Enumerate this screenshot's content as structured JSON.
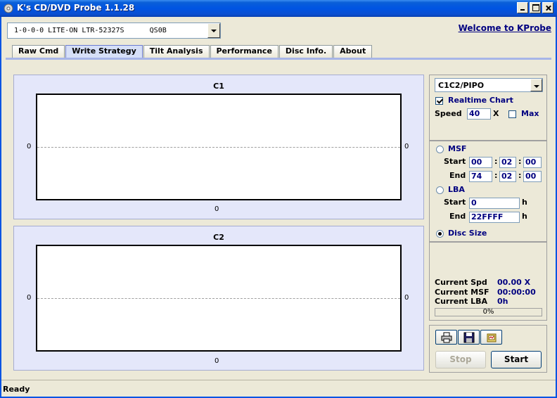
{
  "window": {
    "title": "K's CD/DVD Probe 1.1.28",
    "accent": "#0054e3"
  },
  "drive": {
    "selected": "1-0-0-0 LITE-ON LTR-52327S      QS0B"
  },
  "welcome_link": "Welcome to KProbe",
  "tabs": [
    {
      "label": "Raw Cmd"
    },
    {
      "label": "Write Strategy",
      "active": true
    },
    {
      "label": "Tilt Analysis"
    },
    {
      "label": "Performance"
    },
    {
      "label": "Disc Info."
    },
    {
      "label": "About"
    }
  ],
  "charts": {
    "c1": {
      "title": "C1",
      "y_left": "0",
      "y_right": "0",
      "x_tick": "0"
    },
    "c2": {
      "title": "C2",
      "y_left": "0",
      "y_right": "0",
      "x_tick": "0"
    }
  },
  "chart_data": [
    {
      "type": "line",
      "title": "C1",
      "series": [],
      "yticks": [
        "0"
      ],
      "xticks": [
        "0"
      ],
      "grid": "zero line dashed"
    },
    {
      "type": "line",
      "title": "C2",
      "series": [],
      "yticks": [
        "0"
      ],
      "xticks": [
        "0"
      ],
      "grid": "zero line dashed"
    }
  ],
  "settings": {
    "mode": "C1C2/PIPO",
    "realtime_chart_label": "Realtime Chart",
    "realtime_chart_checked": true,
    "speed_label": "Speed",
    "speed_value": "40",
    "speed_unit": "X",
    "max_label": "Max",
    "max_checked": false
  },
  "range": {
    "msf_label": "MSF",
    "msf_start_label": "Start",
    "msf_start": [
      "00",
      "02",
      "00"
    ],
    "msf_end_label": "End",
    "msf_end": [
      "74",
      "02",
      "00"
    ],
    "lba_label": "LBA",
    "lba_start_label": "Start",
    "lba_start": "0",
    "lba_end_label": "End",
    "lba_end": "22FFFF",
    "hex_unit": "h",
    "disc_size_label": "Disc Size",
    "selected": "Disc Size"
  },
  "status": {
    "current_spd_label": "Current Spd",
    "current_spd": "00.00 X",
    "current_msf_label": "Current MSF",
    "current_msf": "00:00:00",
    "current_lba_label": "Current LBA",
    "current_lba": "0h",
    "progress_text": "0%",
    "progress": 0
  },
  "actions": {
    "stop_label": "Stop",
    "start_label": "Start",
    "print_icon": "printer-icon",
    "save_icon": "floppy-disk-icon",
    "open_icon": "open-file-icon"
  },
  "statusbar": {
    "text": "Ready"
  }
}
